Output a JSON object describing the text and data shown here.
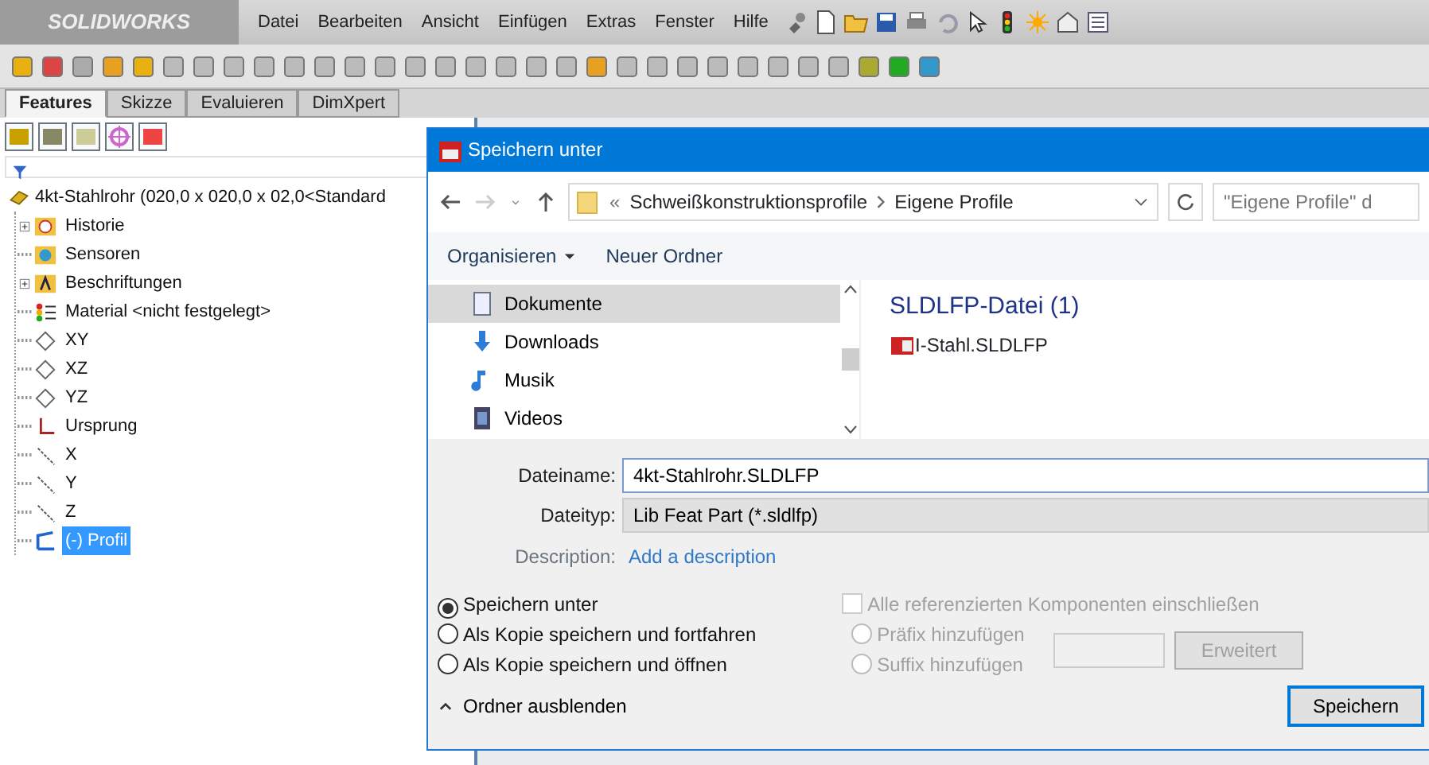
{
  "app": {
    "logo": "SOLIDWORKS",
    "menu": [
      "Datei",
      "Bearbeiten",
      "Ansicht",
      "Einfügen",
      "Extras",
      "Fenster",
      "Hilfe"
    ]
  },
  "tabs": [
    {
      "label": "Features",
      "selected": true
    },
    {
      "label": "Skizze",
      "selected": false
    },
    {
      "label": "Evaluieren",
      "selected": false
    },
    {
      "label": "DimXpert",
      "selected": false
    }
  ],
  "tree": {
    "label": "4kt-Stahlrohr  (020,0 x 020,0 x 02,0<Standard",
    "children": [
      {
        "label": "Historie",
        "kind": "history",
        "expandable": true,
        "selected": false
      },
      {
        "label": "Sensoren",
        "kind": "sensor",
        "expandable": false,
        "selected": false
      },
      {
        "label": "Beschriftungen",
        "kind": "annotation",
        "expandable": true,
        "selected": false
      },
      {
        "label": "Material <nicht festgelegt>",
        "kind": "material",
        "expandable": false,
        "selected": false
      },
      {
        "label": "XY",
        "kind": "plane",
        "expandable": false,
        "selected": false
      },
      {
        "label": "XZ",
        "kind": "plane",
        "expandable": false,
        "selected": false
      },
      {
        "label": "YZ",
        "kind": "plane",
        "expandable": false,
        "selected": false
      },
      {
        "label": "Ursprung",
        "kind": "origin",
        "expandable": false,
        "selected": false
      },
      {
        "label": "X",
        "kind": "axis",
        "expandable": false,
        "selected": false
      },
      {
        "label": "Y",
        "kind": "axis",
        "expandable": false,
        "selected": false
      },
      {
        "label": "Z",
        "kind": "axis",
        "expandable": false,
        "selected": false
      },
      {
        "label": "(-) Profil",
        "kind": "sketch",
        "expandable": false,
        "selected": true
      }
    ]
  },
  "dialog": {
    "title": "Speichern unter",
    "address": {
      "prefix": "«",
      "crumbs": [
        "Schweißkonstruktionsprofile",
        "Eigene Profile"
      ]
    },
    "search": {
      "placeholder": "\"Eigene Profile\" d"
    },
    "commands": [
      {
        "label": "Organisieren",
        "dropdown": true
      },
      {
        "label": "Neuer Ordner",
        "dropdown": false
      }
    ],
    "nav": [
      {
        "label": "Dokumente",
        "kind": "documents",
        "selected": true
      },
      {
        "label": "Downloads",
        "kind": "downloads",
        "selected": false
      },
      {
        "label": "Musik",
        "kind": "music",
        "selected": false
      },
      {
        "label": "Videos",
        "kind": "videos",
        "selected": false
      }
    ],
    "group": "SLDLFP-Datei (1)",
    "files": [
      "I-Stahl.SLDLFP"
    ],
    "filename": {
      "label": "Dateiname:",
      "value": "4kt-Stahlrohr.SLDLFP"
    },
    "filetype": {
      "label": "Dateityp:",
      "value": "Lib Feat Part (*.sldlfp)"
    },
    "description": {
      "label": "Description:",
      "link": "Add a description"
    },
    "save_modes": [
      {
        "label": "Speichern unter",
        "selected": true
      },
      {
        "label": "Als Kopie speichern und fortfahren",
        "selected": false
      },
      {
        "label": "Als Kopie speichern und öffnen",
        "selected": false
      }
    ],
    "include_refs": {
      "label": "Alle referenzierten Komponenten einschließen",
      "checked": false,
      "disabled": true
    },
    "affix": [
      {
        "label": "Präfix hinzufügen",
        "selected": false,
        "disabled": true
      },
      {
        "label": "Suffix hinzufügen",
        "selected": false,
        "disabled": true
      }
    ],
    "advanced": {
      "label": "Erweitert",
      "disabled": true
    },
    "hide_folders": "Ordner ausblenden",
    "save": "Speichern"
  }
}
